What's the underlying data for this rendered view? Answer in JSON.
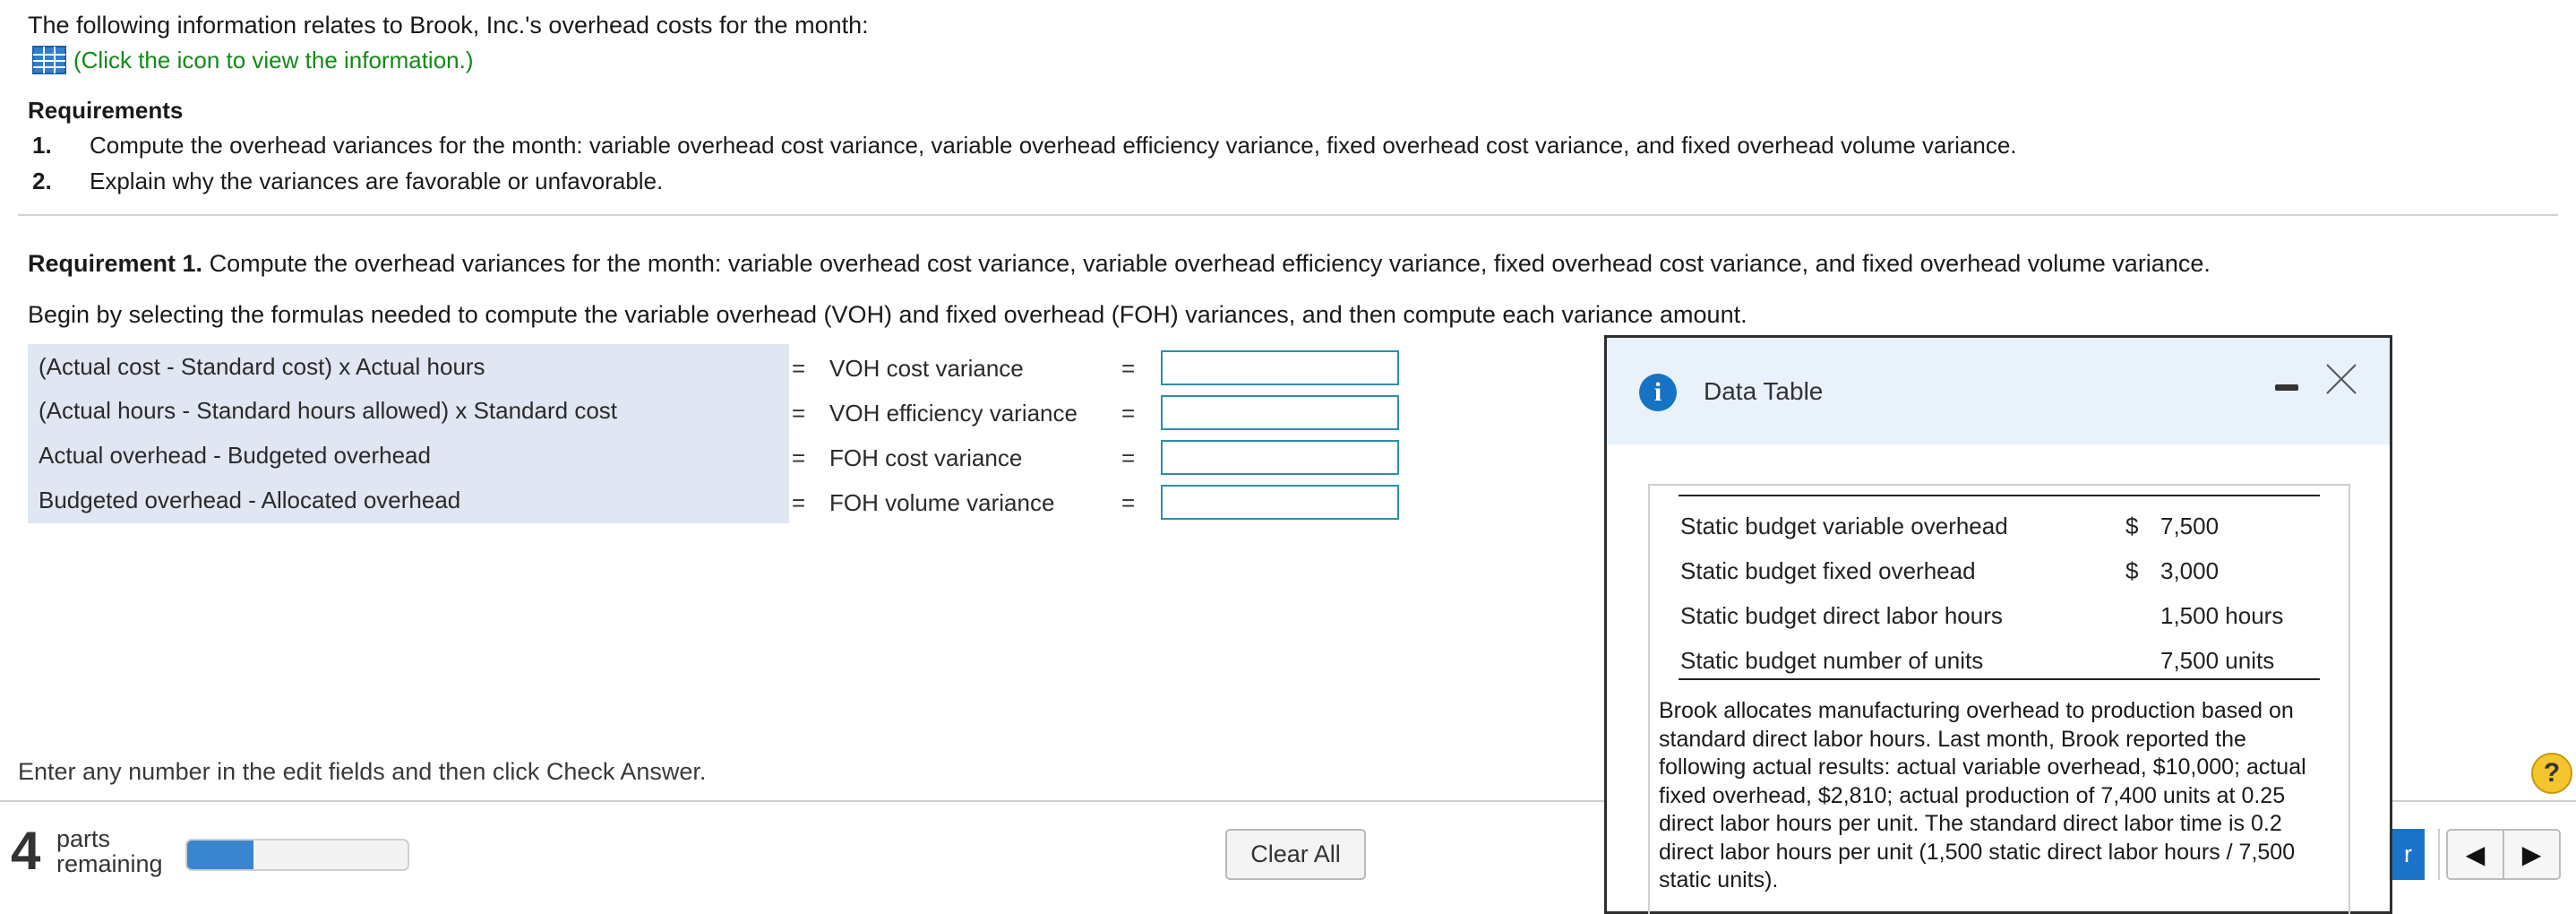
{
  "intro_text": "The following information relates to Brook, Inc.'s overhead costs for the month:",
  "info_link": "(Click the icon to view the information.)",
  "requirements": {
    "title": "Requirements",
    "items": [
      {
        "num": "1.",
        "text": "Compute the overhead variances for the month: variable overhead cost variance, variable overhead efficiency variance, fixed overhead cost variance, and fixed overhead volume variance."
      },
      {
        "num": "2.",
        "text": "Explain why the variances are favorable or unfavorable."
      }
    ]
  },
  "requirement1": {
    "label": "Requirement 1.",
    "text": "Compute the overhead variances for the month: variable overhead cost variance, variable overhead efficiency variance, fixed overhead cost variance, and fixed overhead volume variance."
  },
  "begin_text": "Begin by selecting the formulas needed to compute the variable overhead (VOH) and fixed overhead (FOH) variances, and then compute each variance amount.",
  "formulas": [
    {
      "formula": "(Actual cost - Standard cost) x Actual hours",
      "eq": "=",
      "variance": "VOH cost variance",
      "eq2": "=",
      "value": ""
    },
    {
      "formula": "(Actual hours - Standard hours allowed) x Standard cost",
      "eq": "=",
      "variance": "VOH efficiency variance",
      "eq2": "=",
      "value": ""
    },
    {
      "formula": "Actual overhead - Budgeted overhead",
      "eq": "=",
      "variance": "FOH cost variance",
      "eq2": "=",
      "value": ""
    },
    {
      "formula": "Budgeted overhead - Allocated overhead",
      "eq": "=",
      "variance": "FOH volume variance",
      "eq2": "=",
      "value": ""
    }
  ],
  "hint": "Enter any number in the edit fields and then click Check Answer.",
  "help_label": "?",
  "footer": {
    "parts_count": "4",
    "parts_line1": "parts",
    "parts_line2": "remaining",
    "progress_fraction": 0.3,
    "clear_all": "Clear All",
    "check_answer_partial": "r",
    "prev_glyph": "◀",
    "next_glyph": "▶"
  },
  "data_table": {
    "title": "Data Table",
    "info_glyph": "i",
    "rows": [
      {
        "label": "Static budget variable overhead",
        "dollar": "$",
        "value": "7,500"
      },
      {
        "label": "Static budget fixed overhead",
        "dollar": "$",
        "value": "3,000"
      },
      {
        "label": "Static budget direct labor hours",
        "dollar": "",
        "value": "1,500 hours"
      },
      {
        "label": "Static budget number of units",
        "dollar": "",
        "value": "7,500 units"
      }
    ],
    "note": "Brook allocates manufacturing overhead to production based on standard direct labor hours. Last month, Brook reported the following actual results: actual variable overhead, $10,000; actual fixed overhead, $2,810; actual production of 7,400 units at 0.25 direct labor hours per unit. The standard direct labor time is 0.2 direct labor hours per unit (1,500 static direct labor hours / 7,500 static units)."
  },
  "icons": {
    "table_icon": "grid-table-icon",
    "info_icon": "info-icon",
    "minimize_icon": "minimize-icon",
    "close_icon": "close-icon",
    "help_icon": "help-icon"
  },
  "colors": {
    "link_green": "#128a17",
    "formula_bg": "#e0e6f2",
    "input_border": "#2d8eaa",
    "progress_fill": "#3a85cf",
    "popup_header_bg": "#e9f1fb",
    "info_blue": "#1673c4",
    "check_blue": "#1a73c8",
    "help_yellow": "#f5c52d"
  }
}
